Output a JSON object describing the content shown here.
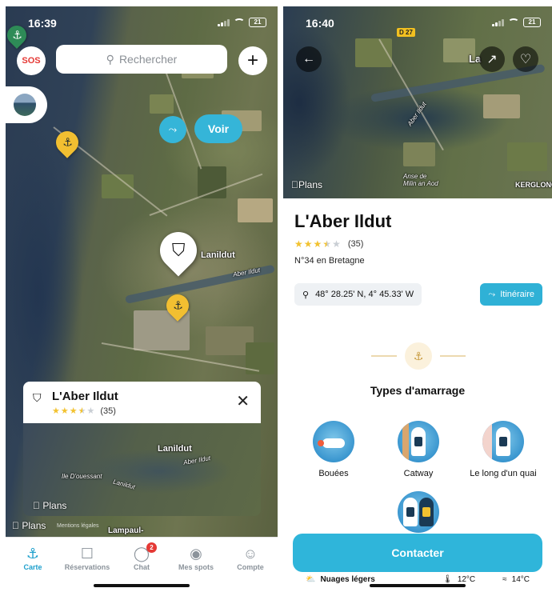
{
  "left": {
    "status": {
      "time": "16:39",
      "battery": "21"
    },
    "top_bar": {
      "sos_label": "SOS",
      "search_placeholder": "Rechercher",
      "plus_label": "+"
    },
    "map_labels": {
      "village": "Lanildut",
      "river": "Aber Ildut"
    },
    "apple_plans": "Plans",
    "legal": "Mentions légales",
    "town_bottom": "Lampaul-",
    "card": {
      "title": "L'Aber Ildut",
      "stars": 3.5,
      "rating_count": "(35)",
      "close": "✕",
      "map_village": "Lanildut",
      "map_river": "Aber Ildut",
      "map_channel": "Ile D'ouessant",
      "map_channel2": "Lanildut",
      "apple_plans": "Plans",
      "voir_label": "Voir"
    },
    "tabs": [
      {
        "label": "Carte",
        "icon": "map-icon",
        "active": true
      },
      {
        "label": "Réservations",
        "icon": "calendar-icon"
      },
      {
        "label": "Chat",
        "icon": "chat-icon",
        "badge": "2"
      },
      {
        "label": "Mes spots",
        "icon": "location-pin-icon"
      },
      {
        "label": "Compte",
        "icon": "account-icon"
      }
    ]
  },
  "right": {
    "status": {
      "time": "16:40",
      "battery": "21"
    },
    "hero": {
      "road_badge": "D 27",
      "place_label": "La",
      "river_label": "Aber Ildut",
      "cove_label": "Anse de Milin an Aod",
      "corner_label": "KERGLONG",
      "apple_plans": "Plans"
    },
    "spot": {
      "title": "L'Aber Ildut",
      "stars": 3.5,
      "rating_count": "(35)",
      "rank": "N°34 en Bretagne",
      "coords": "48° 28.25' N, 4° 45.33' W",
      "itineraire_label": "Itinéraire"
    },
    "mooring": {
      "title": "Types d'amarrage",
      "options": [
        {
          "label": "Bouées"
        },
        {
          "label": "Catway"
        },
        {
          "label": "Le long d'un quai"
        },
        {
          "label": ""
        }
      ]
    },
    "contact_label": "Contacter",
    "weather": {
      "label": "Nuages légers",
      "air_temp": "12°C",
      "water_temp": "14°C"
    }
  },
  "colors": {
    "accent": "#2fb5da",
    "pin_yellow": "#f2bf31",
    "badge_red": "#e53935",
    "star": "#f2c230",
    "star_empty": "#c9ced4"
  }
}
